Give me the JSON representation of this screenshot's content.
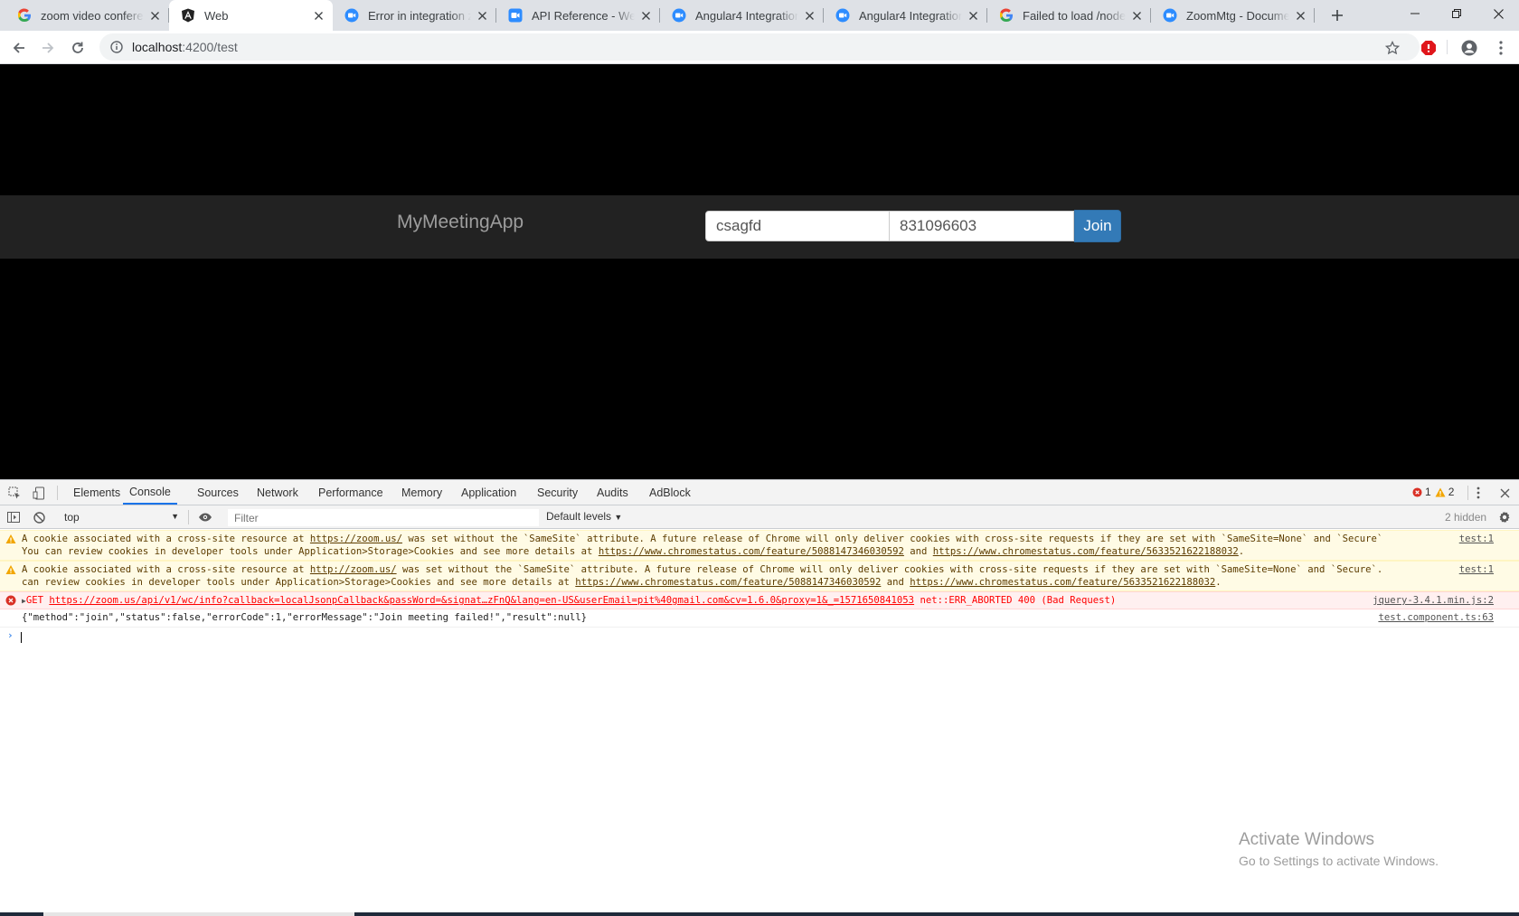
{
  "browser": {
    "tabs": [
      {
        "title": "zoom video conferenc",
        "favicon": "google-icon",
        "active": false
      },
      {
        "title": "Web",
        "favicon": "angular-icon",
        "active": true
      },
      {
        "title": "Error in integration zo",
        "favicon": "zoom-icon",
        "active": false
      },
      {
        "title": "API Reference - Web S",
        "favicon": "zoom-video-icon",
        "active": false
      },
      {
        "title": "Angular4 Integration",
        "favicon": "zoom-icon",
        "active": false
      },
      {
        "title": "Angular4 Integration",
        "favicon": "zoom-icon",
        "active": false
      },
      {
        "title": "Failed to load /node_m",
        "favicon": "google-icon",
        "active": false
      },
      {
        "title": "ZoomMtg - Documen",
        "favicon": "zoom-icon",
        "active": false
      }
    ],
    "address": {
      "host": "localhost",
      "path": ":4200/test"
    }
  },
  "app": {
    "brand": "MyMeetingApp",
    "name_value": "csagfd",
    "meeting_value": "831096603",
    "join_label": "Join"
  },
  "devtools": {
    "tabs": [
      "Elements",
      "Console",
      "Sources",
      "Network",
      "Performance",
      "Memory",
      "Application",
      "Security",
      "Audits",
      "AdBlock"
    ],
    "active_tab": "Console",
    "error_count": "1",
    "warning_count": "2",
    "context": "top",
    "filter_placeholder": "Filter",
    "levels": "Default levels",
    "hidden": "2 hidden",
    "messages": {
      "warn1": {
        "l1a": "A cookie associated with a cross-site resource at ",
        "l1link": "https://zoom.us/",
        "l1b": " was set without the `SameSite` attribute. A future release of Chrome will only deliver cookies with cross-site requests if they are set with `SameSite=None` and `Secure`.",
        "l2a": "You can review cookies in developer tools under Application>Storage>Cookies and see more details at ",
        "l2link1": "https://www.chromestatus.com/feature/5088147346030592",
        "l2and": " and ",
        "l2link2": "https://www.chromestatus.com/feature/5633521622188032",
        "l2end": ".",
        "source": "test:1"
      },
      "warn2": {
        "l1a": "A cookie associated with a cross-site resource at ",
        "l1link": "http://zoom.us/",
        "l1b": " was set without the `SameSite` attribute. A future release of Chrome will only deliver cookies with cross-site requests if they are set with `SameSite=None` and `Secure`. You",
        "l2a": "can review cookies in developer tools under Application>Storage>Cookies and see more details at ",
        "l2link1": "https://www.chromestatus.com/feature/5088147346030592",
        "l2and": " and ",
        "l2link2": "https://www.chromestatus.com/feature/5633521622188032",
        "l2end": ".",
        "source": "test:1"
      },
      "error": {
        "method": "GET",
        "url": "https://zoom.us/api/v1/wc/info?callback=localJsonpCallback&passWord=&signat…zFnQ&lang=en-US&userEmail=pit%40gmail.com&cv=1.6.0&proxy=1&_=1571650841053",
        "status": "net::ERR_ABORTED 400 (Bad Request)",
        "source": "jquery-3.4.1.min.js:2"
      },
      "log": {
        "text": "{\"method\":\"join\",\"status\":false,\"errorCode\":1,\"errorMessage\":\"Join meeting failed!\",\"result\":null}",
        "source": "test.component.ts:63"
      }
    }
  },
  "watermark": {
    "line1": "Activate Windows",
    "line2": "Go to Settings to activate Windows."
  }
}
